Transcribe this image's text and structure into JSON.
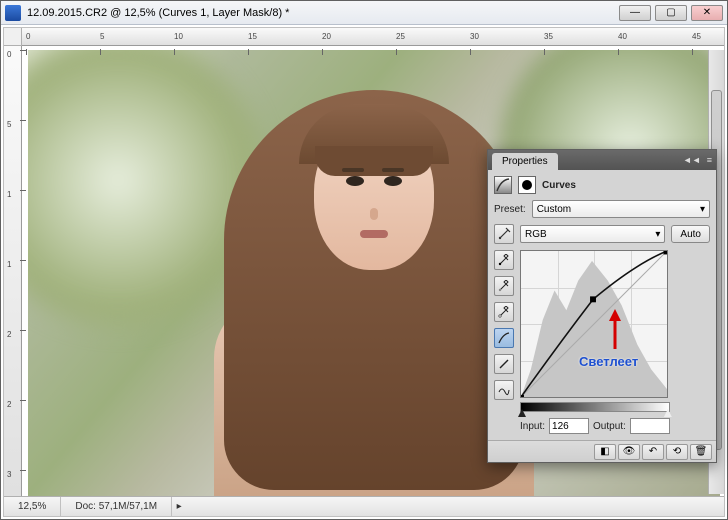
{
  "window": {
    "title": "12.09.2015.CR2 @ 12,5% (Curves 1, Layer Mask/8) *",
    "min": "—",
    "max": "▢",
    "close": "✕"
  },
  "ruler_h": [
    "0",
    "5",
    "10",
    "15",
    "20",
    "25",
    "30",
    "35",
    "40",
    "45"
  ],
  "ruler_v": [
    "0",
    "5",
    "1",
    "1",
    "2",
    "2",
    "3"
  ],
  "status": {
    "zoom": "12,5%",
    "doc": "Doc: 57,1M/57,1M"
  },
  "panel": {
    "tab": "Properties",
    "collapse": "◄◄",
    "menu": "≡",
    "adjustment_name": "Curves",
    "preset_label": "Preset:",
    "preset_value": "Custom",
    "channel_value": "RGB",
    "auto": "Auto",
    "annotation": "Светлеет",
    "input_label": "Input:",
    "input_value": "126",
    "output_label": "Output:",
    "output_value": ""
  },
  "chart_data": {
    "type": "line",
    "title": "Curves",
    "xlabel": "Input",
    "ylabel": "Output",
    "xlim": [
      0,
      255
    ],
    "ylim": [
      0,
      255
    ],
    "series": [
      {
        "name": "baseline",
        "x": [
          0,
          255
        ],
        "y": [
          0,
          255
        ]
      },
      {
        "name": "curve",
        "x": [
          0,
          64,
          126,
          200,
          255
        ],
        "y": [
          0,
          90,
          170,
          232,
          255
        ]
      }
    ],
    "points": [
      {
        "x": 0,
        "y": 0
      },
      {
        "x": 126,
        "y": 170
      },
      {
        "x": 255,
        "y": 255
      }
    ],
    "histogram_peaks_x": [
      40,
      90,
      128,
      180,
      230
    ],
    "annotations": [
      {
        "text": "Светлеет",
        "x": 150,
        "y": 110
      }
    ]
  }
}
